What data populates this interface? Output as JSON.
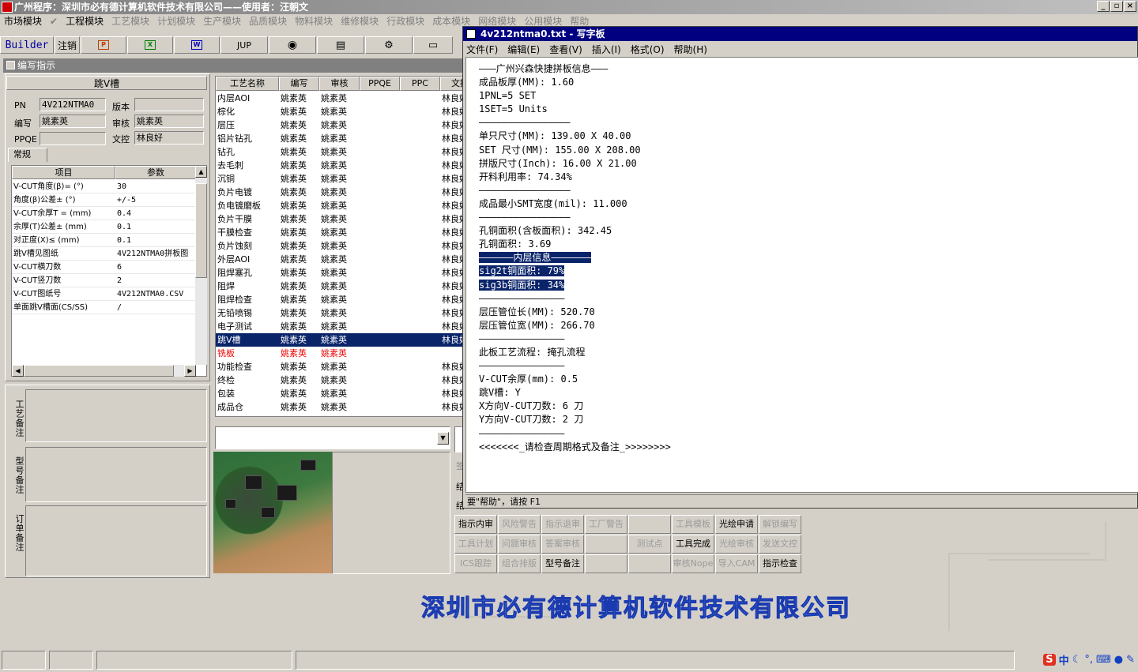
{
  "main_window": {
    "title": "广州程序：深圳市必有德计算机软件技术有限公司——使用者：汪朝文"
  },
  "menubar": [
    "市场模块",
    "工程模块",
    "工艺模块",
    "计划模块",
    "生产模块",
    "品质模块",
    "物料模块",
    "维修模块",
    "行政模块",
    "成本模块",
    "网络模块",
    "公用模块",
    "帮助"
  ],
  "toolbar": {
    "builder": "Builder",
    "logout": "注销",
    "jup": "JUP",
    "icons": [
      "ppt-icon",
      "excel-icon",
      "word-icon",
      "eye-icon",
      "database-icon",
      "tools-icon",
      "printer-icon"
    ]
  },
  "instruction": {
    "title": "编写指示",
    "header": "跳V槽",
    "pn_label": "PN",
    "pn_value": "4V212NTMA0",
    "version_label": "版本",
    "version_value": "",
    "writer_label": "编写",
    "writer_value": "姚素英",
    "review_label": "审核",
    "review_value": "姚素英",
    "ppqe_label": "PPQE",
    "ppqe_value": "",
    "doc_label": "文控",
    "doc_value": "林良好",
    "tab": "常规",
    "param_headers": [
      "项目",
      "参数"
    ],
    "params": [
      [
        "V-CUT角度(β)=  (°)",
        "30"
      ],
      [
        "角度(β)公差±  (°)",
        "+/-5"
      ],
      [
        "V-CUT余厚T =  (mm)",
        "0.4"
      ],
      [
        "余厚(T)公差±  (mm)",
        "0.1"
      ],
      [
        "对正度(X)≤  (mm)",
        "0.1"
      ],
      [
        "跳V槽见图纸",
        "4V212NTMA0拼板图"
      ],
      [
        "V-CUT横刀数",
        "6"
      ],
      [
        "V-CUT竖刀数",
        "2"
      ],
      [
        "V-CUT图纸号",
        "4V212NTMA0.CSV"
      ],
      [
        "单面跳V槽面(CS/SS)",
        "/"
      ]
    ],
    "notes": [
      "工艺备注",
      "型号备注",
      "订单备注"
    ]
  },
  "process_table": {
    "headers": [
      "工艺名称",
      "编写",
      "审核",
      "PPQE",
      "PPC",
      "文控"
    ],
    "rows": [
      [
        "内层AOI",
        "姚素英",
        "姚素英",
        "",
        "",
        "林良好"
      ],
      [
        "棕化",
        "姚素英",
        "姚素英",
        "",
        "",
        "林良好"
      ],
      [
        "层压",
        "姚素英",
        "姚素英",
        "",
        "",
        "林良好"
      ],
      [
        "铝片钻孔",
        "姚素英",
        "姚素英",
        "",
        "",
        "林良好"
      ],
      [
        "钻孔",
        "姚素英",
        "姚素英",
        "",
        "",
        "林良好"
      ],
      [
        "去毛刺",
        "姚素英",
        "姚素英",
        "",
        "",
        "林良好"
      ],
      [
        "沉铜",
        "姚素英",
        "姚素英",
        "",
        "",
        "林良好"
      ],
      [
        "负片电镀",
        "姚素英",
        "姚素英",
        "",
        "",
        "林良好"
      ],
      [
        "负电镀磨板",
        "姚素英",
        "姚素英",
        "",
        "",
        "林良好"
      ],
      [
        "负片干膜",
        "姚素英",
        "姚素英",
        "",
        "",
        "林良好"
      ],
      [
        "干膜检查",
        "姚素英",
        "姚素英",
        "",
        "",
        "林良好"
      ],
      [
        "负片蚀刻",
        "姚素英",
        "姚素英",
        "",
        "",
        "林良好"
      ],
      [
        "外层AOI",
        "姚素英",
        "姚素英",
        "",
        "",
        "林良好"
      ],
      [
        "阻焊塞孔",
        "姚素英",
        "姚素英",
        "",
        "",
        "林良好"
      ],
      [
        "阻焊",
        "姚素英",
        "姚素英",
        "",
        "",
        "林良好"
      ],
      [
        "阻焊检查",
        "姚素英",
        "姚素英",
        "",
        "",
        "林良好"
      ],
      [
        "无铅喷锡",
        "姚素英",
        "姚素英",
        "",
        "",
        "林良好"
      ],
      [
        "电子测试",
        "姚素英",
        "姚素英",
        "",
        "",
        "林良好"
      ],
      [
        "跳V槽",
        "姚素英",
        "姚素英",
        "",
        "",
        "林良好"
      ],
      [
        "铣板",
        "姚素英",
        "姚素英",
        "",
        "",
        ""
      ],
      [
        "功能检查",
        "姚素英",
        "姚素英",
        "",
        "",
        "林良好"
      ],
      [
        "终检",
        "姚素英",
        "姚素英",
        "",
        "",
        "林良好"
      ],
      [
        "包装",
        "姚素英",
        "姚素英",
        "",
        "",
        "林良好"
      ],
      [
        "成品仓",
        "姚素英",
        "姚素英",
        "",
        "",
        "林良好"
      ]
    ]
  },
  "wordpad": {
    "title": "4v212ntma0.txt - 写字板",
    "menu": [
      "文件(F)",
      "编辑(E)",
      "查看(V)",
      "插入(I)",
      "格式(O)",
      "帮助(H)"
    ],
    "lines": [
      "———广州兴森快捷拼板信息———",
      "成品板厚(MM): 1.60",
      "1PNL=5 SET",
      "1SET=5 Units",
      "————————————————",
      "单只尺寸(MM): 139.00 X 40.00",
      "SET 尺寸(MM): 155.00 X 208.00",
      "拼版尺寸(Inch): 16.00 X 21.00",
      "开料利用率: 74.34%",
      "————————————————",
      "成品最小SMT宽度(mil): 11.000",
      "————————————————",
      "孔铜面积(含板面积): 342.45",
      "孔铜面积: 3.69",
      "——————内层信息———————",
      "sig2t铜面积: 79%",
      "sig3b铜面积: 34%",
      "———————————————",
      "层压管位长(MM): 520.70",
      "层压管位宽(MM): 266.70",
      "———————————————",
      "此板工艺流程: 掩孔流程",
      "———————————————",
      "V-CUT余厚(mm): 0.5",
      "跳V槽: Y",
      "X方向V-CUT刀数: 6 刀",
      "Y方向V-CUT刀数: 2 刀",
      "———————————————",
      "<<<<<<<_请检查周期格式及备注_>>>>>>>>"
    ],
    "status": "要\"帮助\"，请按 F1"
  },
  "buttons": [
    [
      "指示内审",
      "风险警告",
      "指示退审",
      "工厂警告",
      "",
      "工具模板",
      "光绘申请",
      "解锁编写"
    ],
    [
      "工具计划",
      "问题审核",
      "答案审核",
      "",
      "测试点",
      "工具完成",
      "光绘审核",
      "发送文控"
    ],
    [
      "ICS跟踪",
      "组合排版",
      "型号备注",
      "",
      "",
      "审核Nope",
      "导入CAM",
      "指示检查"
    ]
  ],
  "button_enabled": [
    [
      true,
      false,
      false,
      false,
      false,
      false,
      true,
      false
    ],
    [
      false,
      false,
      false,
      false,
      false,
      true,
      false,
      false
    ],
    [
      false,
      false,
      true,
      false,
      false,
      false,
      false,
      true
    ]
  ],
  "side_labels": [
    "签",
    "结",
    "结"
  ],
  "banner": "深圳市必有德计算机软件技术有限公司",
  "tray": {
    "ime": "中"
  }
}
